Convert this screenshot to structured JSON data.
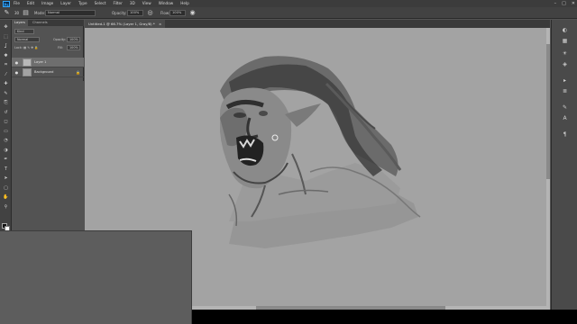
{
  "app": {
    "logo": "Ps"
  },
  "menu": [
    "File",
    "Edit",
    "Image",
    "Layer",
    "Type",
    "Select",
    "Filter",
    "3D",
    "View",
    "Window",
    "Help"
  ],
  "window_controls": [
    "–",
    "□",
    "✕"
  ],
  "options_bar": {
    "brush_size": "30",
    "mode_label": "Mode:",
    "mode_value": "Normal",
    "opacity_label": "Opacity:",
    "opacity_value": "100%",
    "flow_label": "Flow:",
    "flow_value": "100%"
  },
  "layers_panel": {
    "tabs": [
      "Layers",
      "Channels"
    ],
    "kind_filter": "Kind",
    "blend_mode": "Normal",
    "opacity_label": "Opacity:",
    "opacity_value": "100%",
    "lock_label": "Lock:",
    "fill_label": "Fill:",
    "fill_value": "100%",
    "layers": [
      {
        "name": "Layer 1",
        "selected": true,
        "thumb_color": "#b8b8b8"
      },
      {
        "name": "Background",
        "selected": false,
        "thumb_color": "#a3a3a3",
        "locked": true
      }
    ]
  },
  "document": {
    "tab_title": "Untitled-1 @ 66.7% (Layer 1, Gray/8) *",
    "close": "×"
  },
  "tools": [
    "move-tool",
    "marquee-tool",
    "lasso-tool",
    "quick-select-tool",
    "crop-tool",
    "eyedropper-tool",
    "healing-tool",
    "brush-tool",
    "clone-stamp-tool",
    "history-brush-tool",
    "eraser-tool",
    "gradient-tool",
    "blur-tool",
    "dodge-tool",
    "pen-tool",
    "type-tool",
    "path-select-tool",
    "shape-tool",
    "hand-tool",
    "zoom-tool"
  ],
  "colors": {
    "foreground": "#111111",
    "background": "#ffffff",
    "canvas": "#a3a3a3"
  }
}
